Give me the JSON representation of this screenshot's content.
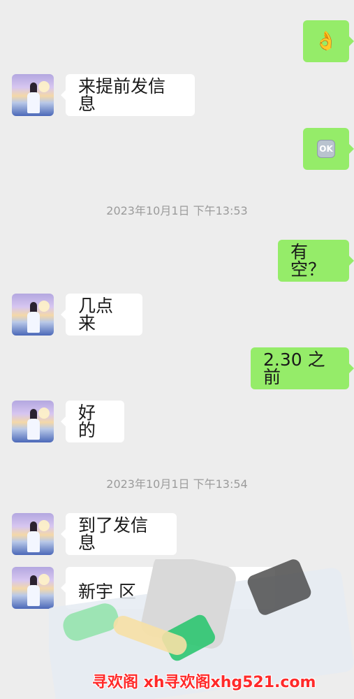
{
  "messages": [
    {
      "side": "right",
      "content": "👌"
    },
    {
      "side": "left",
      "content": "来提前发信息"
    },
    {
      "side": "right",
      "badge": "OK"
    },
    {
      "timestamp": "2023年10月1日 下午13:53"
    },
    {
      "side": "right",
      "content": "有空？"
    },
    {
      "side": "left",
      "content": "几点来"
    },
    {
      "side": "right",
      "content": "2.30 之前"
    },
    {
      "side": "left",
      "content": "好的"
    },
    {
      "timestamp": "2023年10月1日 下午13:54"
    },
    {
      "side": "left",
      "content": "到了发信息"
    },
    {
      "side": "left",
      "partial_content": "新宇 区"
    }
  ],
  "watermark": "寻欢阁 xh寻欢阁xhg521.com",
  "colors": {
    "background": "#ededed",
    "left_bubble": "#ffffff",
    "right_bubble": "#95ec69",
    "timestamp": "#9b9b9b",
    "watermark": "#ff2a2a"
  }
}
